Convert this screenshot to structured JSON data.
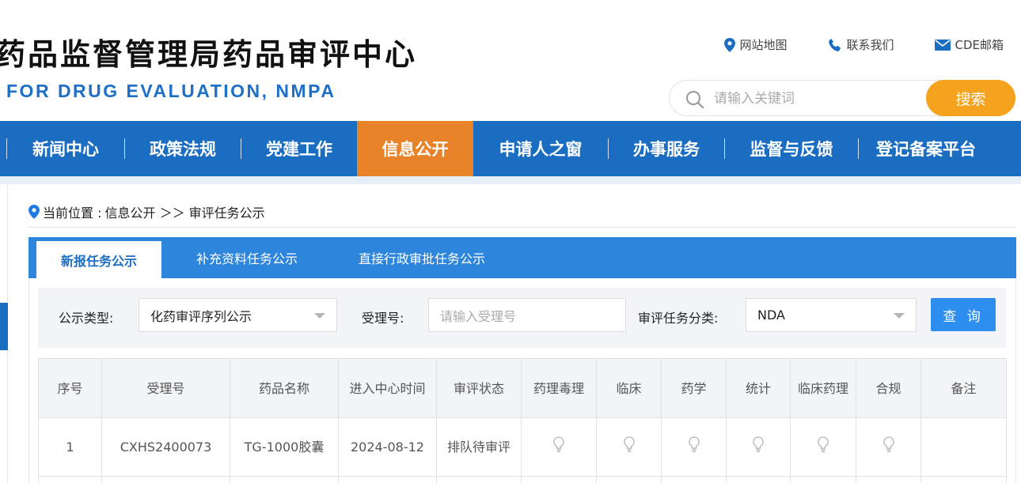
{
  "header": {
    "title_cn": "药品监督管理局药品审评中心",
    "title_en": "FOR DRUG EVALUATION, NMPA",
    "links": [
      {
        "label": "网站地图",
        "icon": "location-pin-icon"
      },
      {
        "label": "联系我们",
        "icon": "phone-icon"
      },
      {
        "label": "CDE邮箱",
        "icon": "mail-icon"
      }
    ],
    "search_placeholder": "请输入关键词",
    "search_button": "搜索"
  },
  "nav": {
    "items": [
      "新闻中心",
      "政策法规",
      "党建工作",
      "信息公开",
      "申请人之窗",
      "办事服务",
      "监督与反馈",
      "登记备案平台"
    ],
    "active": "信息公开"
  },
  "breadcrumb": {
    "prefix": "当前位置 : ",
    "path": "信息公开 ＞＞ 审评任务公示"
  },
  "tabs": [
    "新报任务公示",
    "补充资料任务公示",
    "直接行政审批任务公示"
  ],
  "filter": {
    "type_label": "公示类型:",
    "type_value": "化药审评序列公示",
    "accept_label": "受理号:",
    "accept_placeholder": "请输入受理号",
    "category_label": "审评任务分类:",
    "category_value": "NDA",
    "query_button": "查 询"
  },
  "table": {
    "headers": [
      "序号",
      "受理号",
      "药品名称",
      "进入中心时间",
      "审评状态",
      "药理毒理",
      "临床",
      "药学",
      "统计",
      "临床药理",
      "合规",
      "备注"
    ],
    "rows": [
      {
        "index": "1",
        "accept_no": "CXHS2400073",
        "drug_name": "TG-1000胶囊",
        "entry_time": "2024-08-12",
        "status": "排队待审评",
        "remark": ""
      }
    ]
  },
  "colors": {
    "nav_blue": "#1b6dc1",
    "active_orange": "#e9832a",
    "search_orange": "#f5a21f",
    "tab_blue": "#2e86dc",
    "query_blue": "#2e8ef0"
  }
}
